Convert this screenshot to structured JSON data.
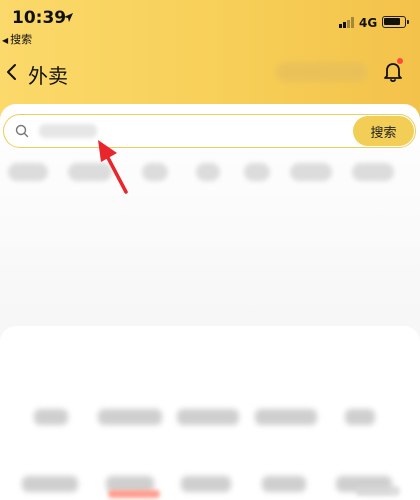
{
  "status_bar": {
    "time": "10:39",
    "back_app_label": "搜索",
    "network": "4G",
    "battery_percent": 85
  },
  "nav": {
    "title": "外卖"
  },
  "search": {
    "value": "",
    "placeholder": "",
    "button_label": "搜索"
  },
  "colors": {
    "accent_yellow": "#f2ce56",
    "search_border": "#eccf5d",
    "notification_dot": "#ff4a3a",
    "annotation_arrow": "#e8262b"
  },
  "icons": {
    "back": "chevron-left-icon",
    "search": "search-icon",
    "bell": "bell-icon",
    "location": "location-arrow-icon"
  }
}
